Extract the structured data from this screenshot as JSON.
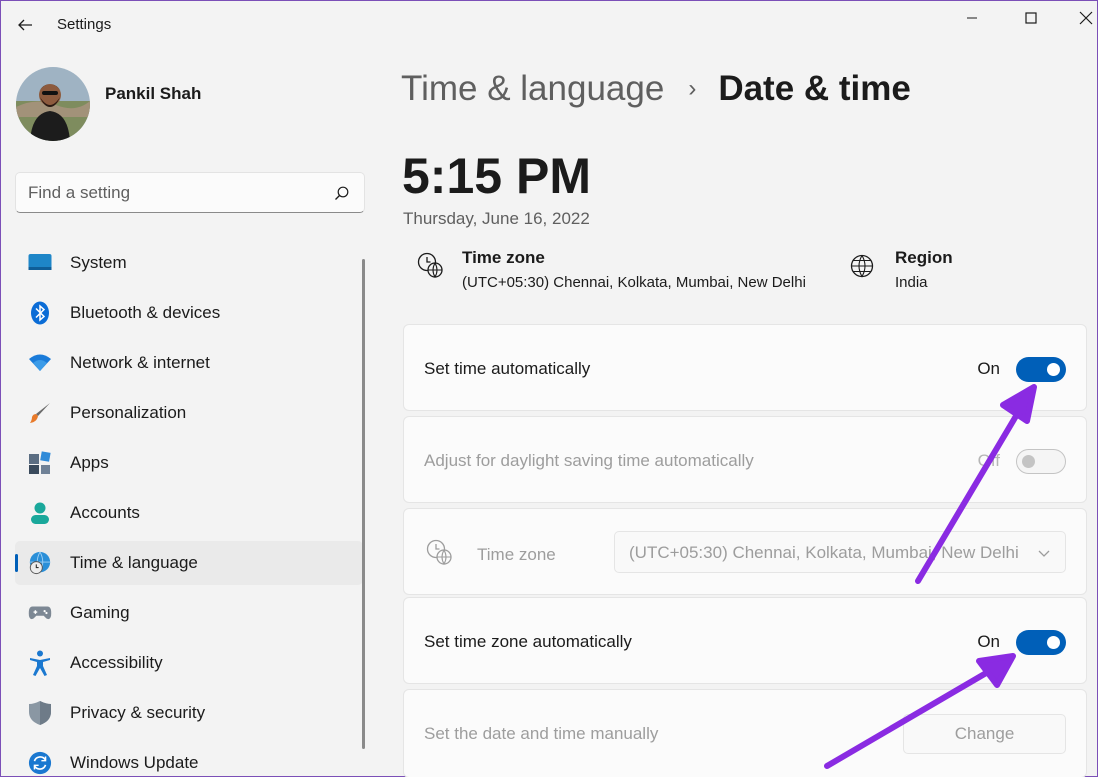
{
  "window": {
    "title": "Settings"
  },
  "profile": {
    "name": "Pankil Shah"
  },
  "search": {
    "placeholder": "Find a setting"
  },
  "sidebar": {
    "items": [
      {
        "label": "System",
        "icon": "monitor-icon"
      },
      {
        "label": "Bluetooth & devices",
        "icon": "bluetooth-icon"
      },
      {
        "label": "Network & internet",
        "icon": "wifi-icon"
      },
      {
        "label": "Personalization",
        "icon": "brush-icon"
      },
      {
        "label": "Apps",
        "icon": "apps-icon"
      },
      {
        "label": "Accounts",
        "icon": "accounts-icon"
      },
      {
        "label": "Time & language",
        "icon": "time-language-icon",
        "active": true
      },
      {
        "label": "Gaming",
        "icon": "gamepad-icon"
      },
      {
        "label": "Accessibility",
        "icon": "accessibility-icon"
      },
      {
        "label": "Privacy & security",
        "icon": "shield-icon"
      },
      {
        "label": "Windows Update",
        "icon": "update-icon"
      }
    ]
  },
  "header": {
    "parent": "Time & language",
    "separator": "›",
    "current": "Date & time"
  },
  "clock": {
    "time": "5:15 PM",
    "date": "Thursday, June 16, 2022"
  },
  "info": {
    "timezone": {
      "title": "Time zone",
      "value": "(UTC+05:30) Chennai, Kolkata, Mumbai, New Delhi"
    },
    "region": {
      "title": "Region",
      "value": "India"
    }
  },
  "settings": {
    "set_time_auto": {
      "label": "Set time automatically",
      "state": "On"
    },
    "daylight": {
      "label": "Adjust for daylight saving time automatically",
      "state": "Off"
    },
    "timezone": {
      "label": "Time zone",
      "value": "(UTC+05:30) Chennai, Kolkata, Mumbai, New Delhi"
    },
    "set_tz_auto": {
      "label": "Set time zone automatically",
      "state": "On"
    },
    "manual": {
      "label": "Set the date and time manually",
      "button": "Change"
    }
  },
  "colors": {
    "accent": "#005fb8",
    "annotation": "#8a2be2"
  }
}
